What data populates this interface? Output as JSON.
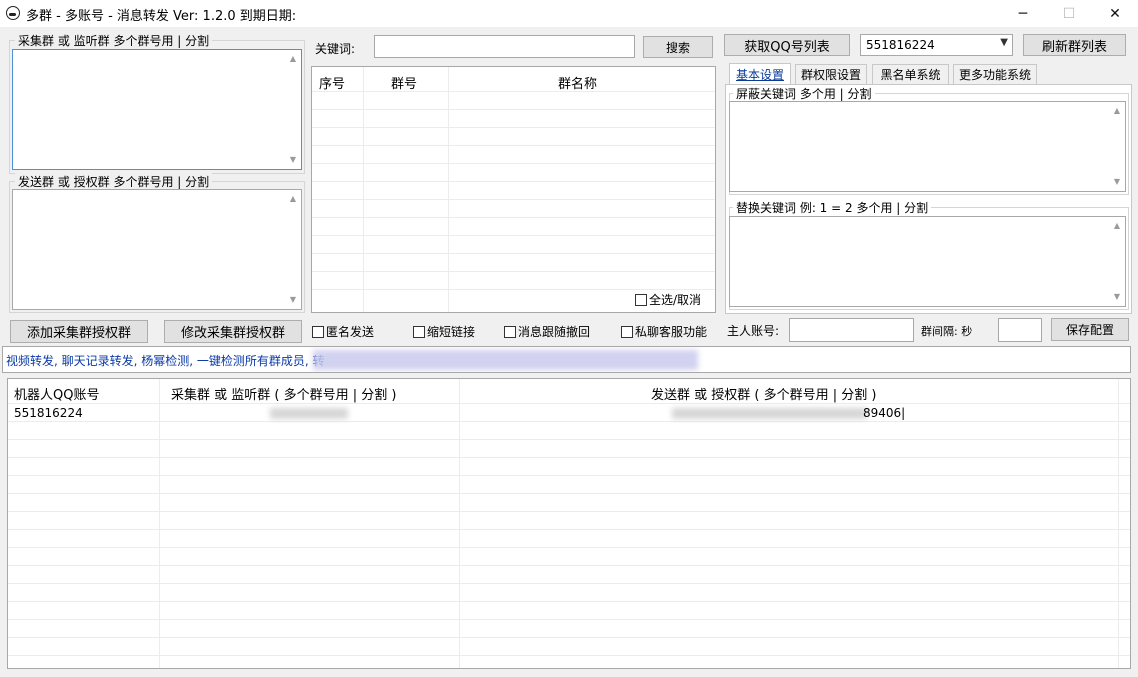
{
  "window": {
    "title": "多群 - 多账号 - 消息转发  Ver: 1.2.0  到期日期:",
    "minimize": "─",
    "maximize": "☐",
    "close": "✕"
  },
  "left": {
    "collect_group_label": "采集群 或 监听群 多个群号用 | 分割",
    "collect_group_value": "",
    "send_group_label": "发送群 或 授权群 多个群号用 | 分割",
    "send_group_value": "",
    "add_button": "添加采集群授权群",
    "modify_button": "修改采集群授权群"
  },
  "middle": {
    "keyword_label": "关键词:",
    "keyword_value": "",
    "search_button": "搜索",
    "columns": [
      "序号",
      "群号",
      "群名称"
    ],
    "select_all": "全选/取消"
  },
  "top_right": {
    "fetch_qq_button": "获取QQ号列表",
    "account_selected": "551816224",
    "refresh_button": "刷新群列表"
  },
  "tabs": [
    "基本设置",
    "群权限设置",
    "黑名单系统",
    "更多功能系统"
  ],
  "settings": {
    "block_keywords_label": "屏蔽关键词 多个用 | 分割",
    "replace_keywords_label": "替换关键词 例: 1 = 2 多个用 | 分割"
  },
  "options": {
    "anonymous": "匿名发送",
    "short_link": "缩短链接",
    "follow_recall": "消息跟随撤回",
    "private_service": "私聊客服功能",
    "owner_label": "主人账号:",
    "owner_value": "",
    "interval_label": "群间隔: 秒",
    "interval_value": "",
    "save_button": "保存配置"
  },
  "marquee": {
    "text": "视频转发, 聊天记录转发, 杨幂检测, 一键检测所有群成员, 转"
  },
  "bottom_table": {
    "columns": [
      "机器人QQ账号",
      "采集群 或 监听群 ( 多个群号用 | 分割 )",
      "发送群 或 授权群 ( 多个群号用 | 分割 )"
    ],
    "rows": [
      {
        "account": "551816224",
        "collect": "",
        "send": "89406|"
      }
    ]
  },
  "icons": [
    "app-icon",
    "chevron-up-icon",
    "chevron-down-icon",
    "dropdown-arrow-icon"
  ]
}
